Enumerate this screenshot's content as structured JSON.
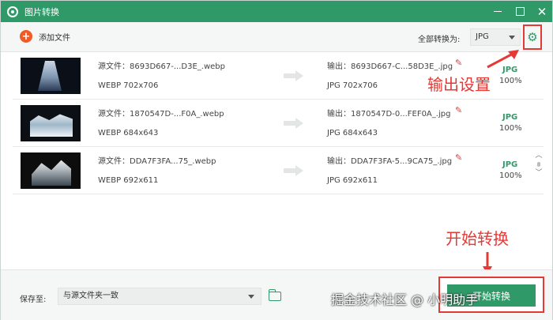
{
  "window": {
    "title": "图片转换"
  },
  "toolbar": {
    "add_file_label": "添加文件",
    "convert_all_label": "全部转换为:",
    "format_value": "JPG"
  },
  "files": [
    {
      "source_name": "源文件：8693D667-...D3E_.webp",
      "source_meta": "WEBP  702x706",
      "output_name": "输出：8693D667-C...58D3E_.jpg",
      "output_meta": "JPG  702x706",
      "badge_format": "JPG",
      "progress": "100%"
    },
    {
      "source_name": "源文件：1870547D-...F0A_.webp",
      "source_meta": "WEBP  684x643",
      "output_name": "输出：1870547D-0...FEF0A_.jpg",
      "output_meta": "JPG  684x643",
      "badge_format": "JPG",
      "progress": "100%"
    },
    {
      "source_name": "源文件：DDA7F3FA...75_.webp",
      "source_meta": "WEBP  692x611",
      "output_name": "输出：DDA7F3FA-5...9CA75_.jpg",
      "output_meta": "JPG  692x611",
      "badge_format": "JPG",
      "progress": "100%"
    }
  ],
  "annotations": {
    "settings": "输出设置",
    "start": "开始转换"
  },
  "footer": {
    "save_label": "保存至:",
    "save_value": "与源文件夹一致",
    "start_button": "开始转换"
  },
  "watermark": "掘金技术社区 @ 小明助手",
  "colors": {
    "brand": "#2f9a68",
    "accent": "#f15a24",
    "annotation": "#e53935"
  }
}
